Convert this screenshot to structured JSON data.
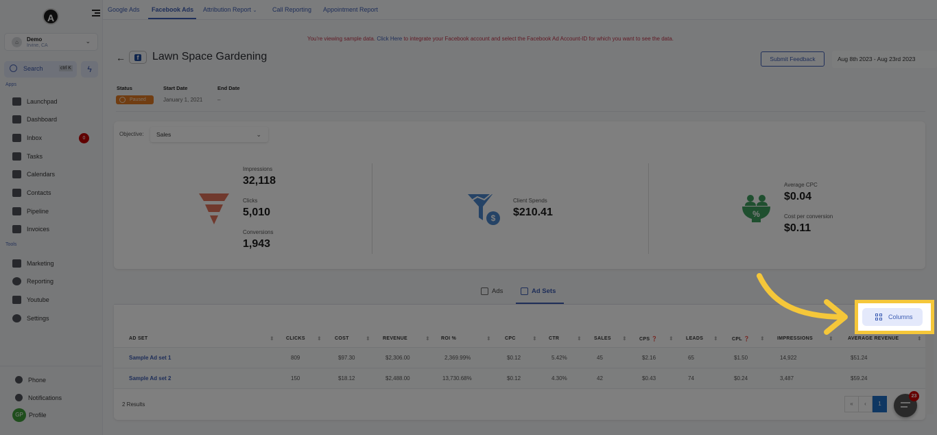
{
  "sidebar": {
    "logo": "A",
    "location": {
      "name": "Demo",
      "sub": "Irvine, CA"
    },
    "search": {
      "label": "Search",
      "shortcut": "ctrl K"
    },
    "apps_label": "Apps",
    "apps": [
      {
        "label": "Launchpad",
        "icon": "rocket-icon"
      },
      {
        "label": "Dashboard",
        "icon": "dashboard-icon"
      },
      {
        "label": "Inbox",
        "icon": "inbox-icon",
        "badge": "0"
      },
      {
        "label": "Tasks",
        "icon": "clipboard-icon"
      },
      {
        "label": "Calendars",
        "icon": "calendar-icon"
      },
      {
        "label": "Contacts",
        "icon": "person-icon"
      },
      {
        "label": "Pipeline",
        "icon": "funnel-icon"
      },
      {
        "label": "Invoices",
        "icon": "invoice-icon"
      }
    ],
    "tools_label": "Tools",
    "tools": [
      {
        "label": "Marketing",
        "icon": "megaphone-icon"
      },
      {
        "label": "Reporting",
        "icon": "pie-chart-icon"
      },
      {
        "label": "Youtube",
        "icon": "youtube-icon"
      },
      {
        "label": "Settings",
        "icon": "gear-icon"
      }
    ],
    "bottom": [
      {
        "label": "Phone",
        "icon": "phone-icon"
      },
      {
        "label": "Notifications",
        "icon": "bell-icon"
      },
      {
        "label": "Profile",
        "avatar": "GP"
      }
    ]
  },
  "topnav": {
    "tabs": [
      "Google Ads",
      "Facebook Ads",
      "Attribution Report",
      "Call Reporting",
      "Appointment Report"
    ],
    "active": "Facebook Ads"
  },
  "notice": {
    "before": "You're viewing sample data.",
    "link": "Click Here",
    "after": "to integrate your Facebook account and select the Facebook Ad Account-ID for which you want to see the data."
  },
  "header": {
    "title": "Lawn Space Gardening",
    "feedback_label": "Submit Feedback",
    "date_range": "Aug 8th 2023 - Aug 23rd 2023"
  },
  "meta": {
    "status_label": "Status",
    "status": "Paused",
    "start_label": "Start Date",
    "start": "January 1, 2021",
    "end_label": "End Date",
    "end": "–"
  },
  "objective": {
    "label": "Objective:",
    "value": "Sales"
  },
  "stats": {
    "impressions_label": "Impressions",
    "impressions": "32,118",
    "clicks_label": "Clicks",
    "clicks": "5,010",
    "conversions_label": "Conversions",
    "conversions": "1,943",
    "spends_label": "Client Spends",
    "spends": "$210.41",
    "avg_cpc_label": "Average CPC",
    "avg_cpc": "$0.04",
    "cpconv_label": "Cost per conversion",
    "cpconv": "$0.11"
  },
  "subtabs": {
    "ads": "Ads",
    "adsets": "Ad Sets",
    "active": "Ad Sets"
  },
  "columns_button": "Columns",
  "table": {
    "headers": [
      "AD SET",
      "CLICKS",
      "COST",
      "REVENUE",
      "ROI %",
      "CPC",
      "CTR",
      "SALES",
      "CPS",
      "LEADS",
      "CPL",
      "IMPRESSIONS",
      "AVERAGE REVENUE"
    ],
    "rows": [
      [
        "Sample Ad set 1",
        "809",
        "$97.30",
        "$2,306.00",
        "2,369.99%",
        "$0.12",
        "5.42%",
        "45",
        "$2.16",
        "65",
        "$1.50",
        "14,922",
        "$51.24"
      ],
      [
        "Sample Ad set 2",
        "150",
        "$18.12",
        "$2,488.00",
        "13,730.68%",
        "$0.12",
        "4.30%",
        "42",
        "$0.43",
        "74",
        "$0.24",
        "3,487",
        "$59.24"
      ]
    ],
    "results": "2 Results"
  },
  "pagination": {
    "first": "«",
    "prev": "‹",
    "current": "1"
  },
  "chat": {
    "badge": "23"
  },
  "colors": {
    "accent": "#3d5db3",
    "highlight": "#f5c73a",
    "paused": "#e07a25"
  }
}
